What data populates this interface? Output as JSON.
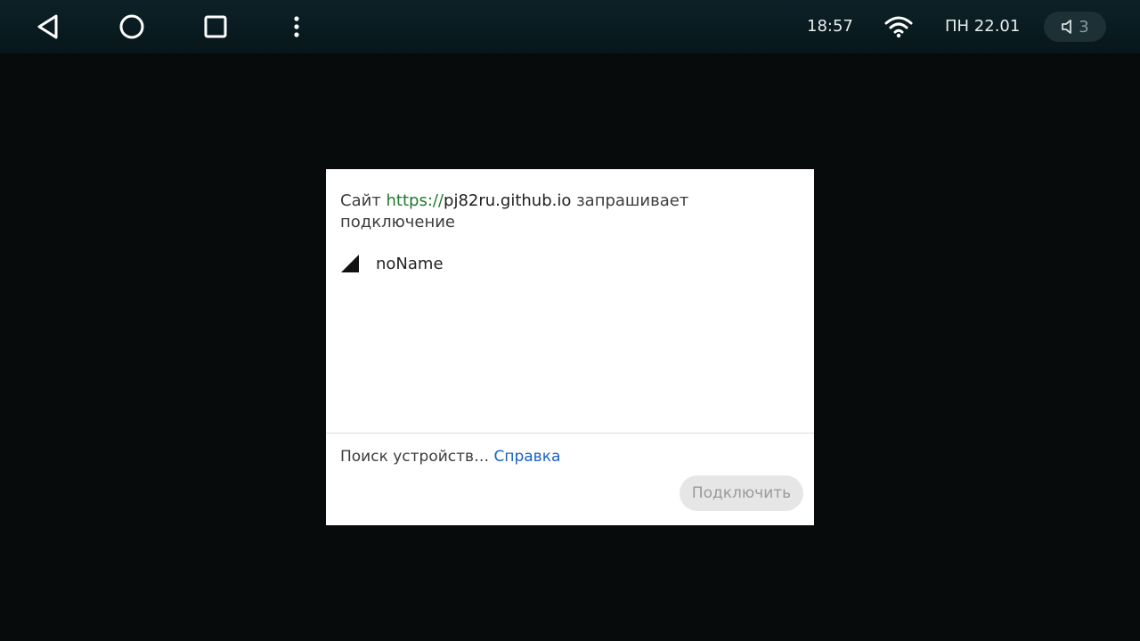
{
  "statusbar": {
    "time": "18:57",
    "date": "ПН 22.01",
    "volume_level": "3",
    "icons": {
      "back": "back-icon",
      "home": "home-icon",
      "recents": "recents-icon",
      "menu": "more-vert-icon",
      "wifi": "wifi-icon",
      "volume": "volume-icon"
    }
  },
  "dialog": {
    "title_prefix": "Сайт ",
    "url_scheme": "https://",
    "url_host": "pj82ru.github.io",
    "title_suffix": " запрашивает подключение",
    "device": {
      "icon": "signal-strength-icon",
      "name": "noName"
    },
    "status_text": "Поиск устройств… ",
    "help_link": "Справка",
    "connect_button": "Подключить"
  },
  "colors": {
    "statusbar_bg": "#0c2228",
    "scheme_green": "#1e7a2e",
    "link_blue": "#1a62c4",
    "button_disabled_bg": "#e6e6e6"
  }
}
